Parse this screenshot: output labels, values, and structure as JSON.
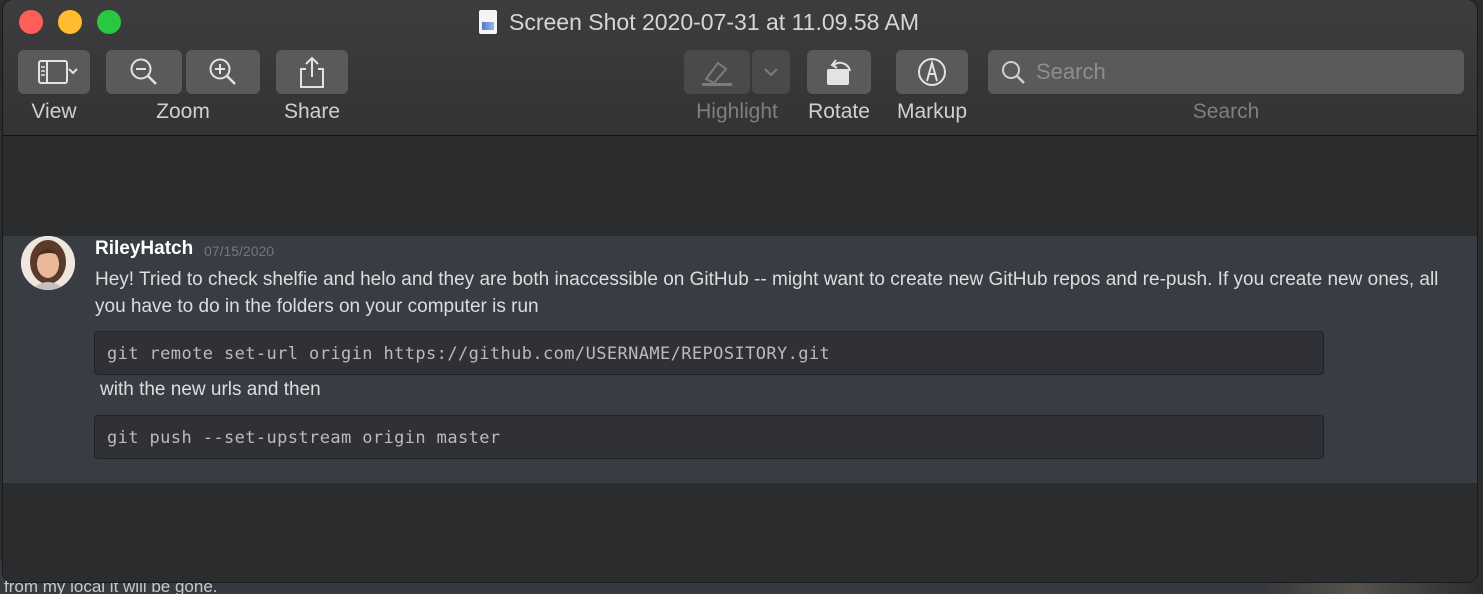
{
  "background": {
    "partial_text": "from my local it will be gone."
  },
  "window": {
    "title": "Screen Shot 2020-07-31 at 11.09.58 AM"
  },
  "toolbar": {
    "view_label": "View",
    "zoom_label": "Zoom",
    "share_label": "Share",
    "highlight_label": "Highlight",
    "rotate_label": "Rotate",
    "markup_label": "Markup",
    "search_label": "Search",
    "search_placeholder": "Search"
  },
  "message": {
    "username": "RileyHatch",
    "timestamp": "07/15/2020",
    "text": "Hey! Tried to check shelfie and helo and they are both inaccessible on GitHub -- might want to create new GitHub repos and re-push. If you create new ones, all you have to do in the folders on your computer is run",
    "code1": "git remote set-url origin https://github.com/USERNAME/REPOSITORY.git",
    "middle_text": "with the new urls and then",
    "code2": "git push --set-upstream origin master"
  },
  "colors": {
    "close": "#fe5f57",
    "minimize": "#febc2e",
    "maximize": "#28c840",
    "message_bg": "#393c43"
  }
}
